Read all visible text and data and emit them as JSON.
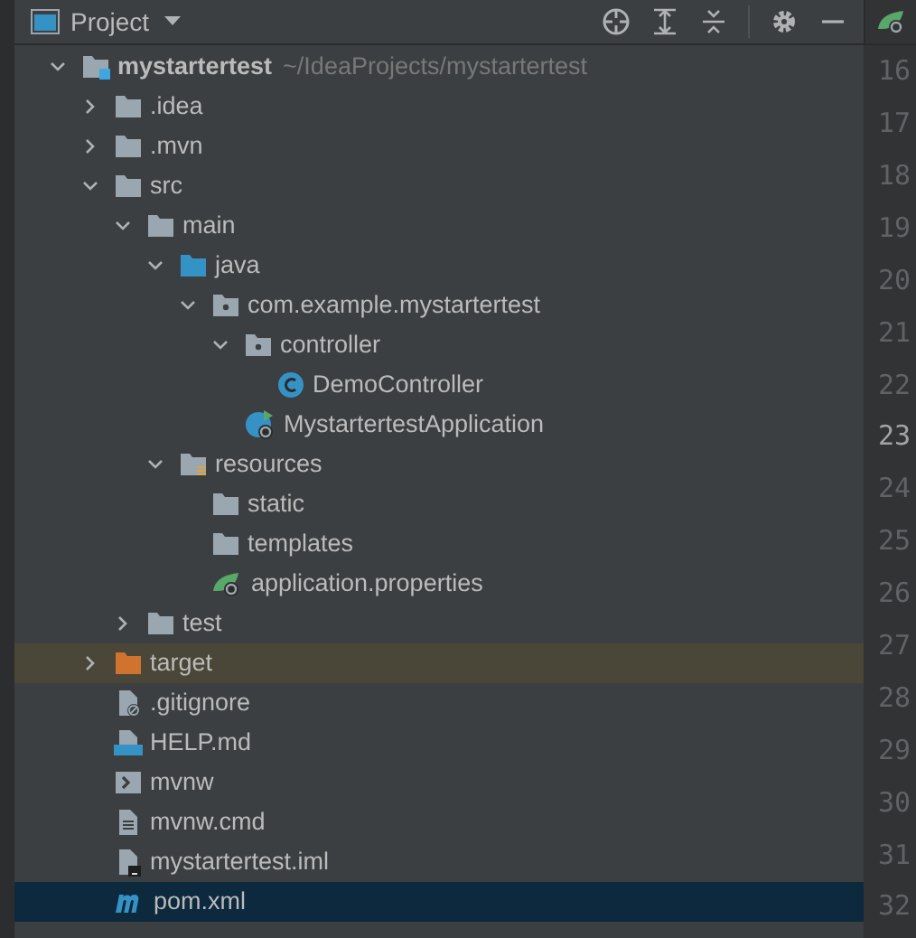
{
  "panel": {
    "title": "Project"
  },
  "tree": [
    {
      "label": "mystartertest",
      "path": "~/IdeaProjects/mystartertest",
      "kind": "project",
      "expanded": true,
      "selected": false,
      "highlighted": false,
      "children": [
        {
          "label": ".idea",
          "kind": "folder",
          "expanded": false,
          "selected": false,
          "highlighted": false
        },
        {
          "label": ".mvn",
          "kind": "folder",
          "expanded": false,
          "selected": false,
          "highlighted": false
        },
        {
          "label": "src",
          "kind": "folder",
          "expanded": true,
          "selected": false,
          "highlighted": false,
          "children": [
            {
              "label": "main",
              "kind": "folder",
              "expanded": true,
              "selected": false,
              "highlighted": false,
              "children": [
                {
                  "label": "java",
                  "kind": "source",
                  "expanded": true,
                  "selected": false,
                  "highlighted": false,
                  "children": [
                    {
                      "label": "com.example.mystartertest",
                      "kind": "package",
                      "expanded": true,
                      "selected": false,
                      "highlighted": false,
                      "children": [
                        {
                          "label": "controller",
                          "kind": "package",
                          "expanded": true,
                          "selected": false,
                          "highlighted": false,
                          "children": [
                            {
                              "label": "DemoController",
                              "kind": "class",
                              "selected": false,
                              "highlighted": false
                            }
                          ]
                        },
                        {
                          "label": "MystartertestApplication",
                          "kind": "app",
                          "selected": false,
                          "highlighted": false
                        }
                      ]
                    }
                  ]
                },
                {
                  "label": "resources",
                  "kind": "resources",
                  "expanded": true,
                  "selected": false,
                  "highlighted": false,
                  "children": [
                    {
                      "label": "static",
                      "kind": "folder",
                      "selected": false,
                      "highlighted": false
                    },
                    {
                      "label": "templates",
                      "kind": "folder",
                      "selected": false,
                      "highlighted": false
                    },
                    {
                      "label": "application.properties",
                      "kind": "config",
                      "selected": false,
                      "highlighted": false
                    }
                  ]
                }
              ]
            },
            {
              "label": "test",
              "kind": "folder",
              "expanded": false,
              "selected": false,
              "highlighted": false
            }
          ]
        },
        {
          "label": "target",
          "kind": "excluded",
          "expanded": false,
          "selected": false,
          "highlighted": true
        },
        {
          "label": ".gitignore",
          "kind": "ignore",
          "selected": false,
          "highlighted": false
        },
        {
          "label": "HELP.md",
          "kind": "markdown",
          "selected": false,
          "highlighted": false
        },
        {
          "label": "mvnw",
          "kind": "shell",
          "selected": false,
          "highlighted": false
        },
        {
          "label": "mvnw.cmd",
          "kind": "text",
          "selected": false,
          "highlighted": false
        },
        {
          "label": "mystartertest.iml",
          "kind": "iml",
          "selected": false,
          "highlighted": false
        },
        {
          "label": "pom.xml",
          "kind": "maven",
          "selected": true,
          "highlighted": false
        }
      ]
    }
  ],
  "gutter": {
    "lines": [
      {
        "number": "16",
        "current": false
      },
      {
        "number": "17",
        "current": false
      },
      {
        "number": "18",
        "current": false
      },
      {
        "number": "19",
        "current": false
      },
      {
        "number": "20",
        "current": false
      },
      {
        "number": "21",
        "current": false
      },
      {
        "number": "22",
        "current": false
      },
      {
        "number": "23",
        "current": true
      },
      {
        "number": "24",
        "current": false
      },
      {
        "number": "25",
        "current": false
      },
      {
        "number": "26",
        "current": false
      },
      {
        "number": "27",
        "current": false
      },
      {
        "number": "28",
        "current": false
      },
      {
        "number": "29",
        "current": false
      },
      {
        "number": "30",
        "current": false
      },
      {
        "number": "31",
        "current": false
      },
      {
        "number": "32",
        "current": false
      }
    ]
  }
}
